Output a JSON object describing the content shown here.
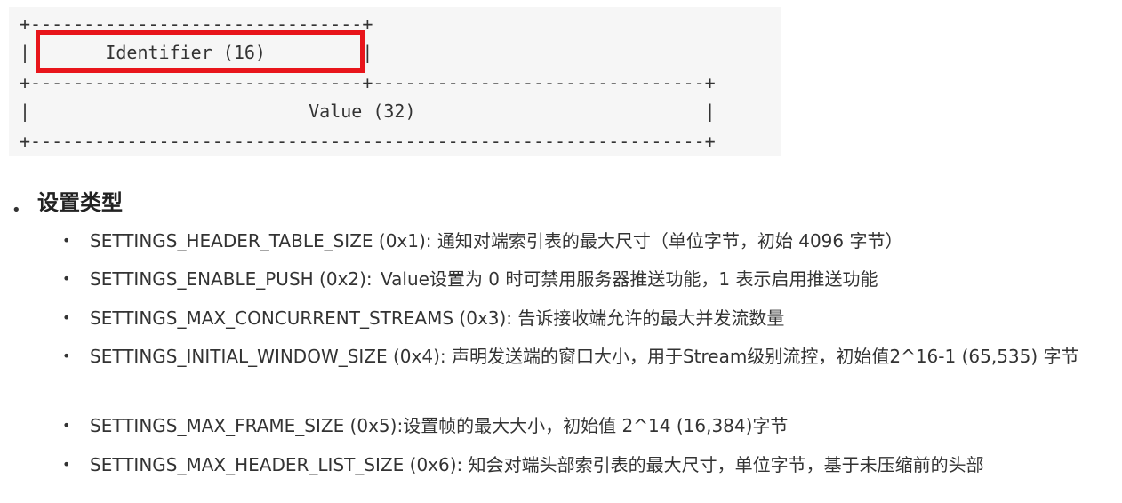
{
  "code_block": {
    "lines": [
      "+-------------------------------+",
      "|       Identifier (16)         |",
      "+-------------------------------+-------------------------------+",
      "|                          Value (32)                           |",
      "+---------------------------------------------------------------+"
    ],
    "highlight_color": "#e8151b"
  },
  "section": {
    "bullet": "•",
    "title": "设置类型"
  },
  "settings": [
    {
      "bullet": "•",
      "text": "SETTINGS_HEADER_TABLE_SIZE (0x1): 通知对端索引表的最大尺寸（单位字节，初始 4096 字节）"
    },
    {
      "bullet": "•",
      "text_before_cursor": "SETTINGS_ENABLE_PUSH (0x2):",
      "text_after_cursor": " Value设置为 0 时可禁用服务器推送功能，1 表示启用推送功能"
    },
    {
      "bullet": "•",
      "text": "SETTINGS_MAX_CONCURRENT_STREAMS (0x3): 告诉接收端允许的最大并发流数量"
    },
    {
      "bullet": "•",
      "text": "SETTINGS_INITIAL_WINDOW_SIZE (0x4): 声明发送端的窗口大小，用于Stream级别流控，初始值2^16-1 (65,535) 字节"
    },
    {
      "bullet": "•",
      "text": "SETTINGS_MAX_FRAME_SIZE (0x5):设置帧的最大大小，初始值 2^14 (16,384)字节"
    },
    {
      "bullet": "•",
      "text": "SETTINGS_MAX_HEADER_LIST_SIZE (0x6): 知会对端头部索引表的最大尺寸，单位字节，基于未压缩前的头部"
    }
  ]
}
